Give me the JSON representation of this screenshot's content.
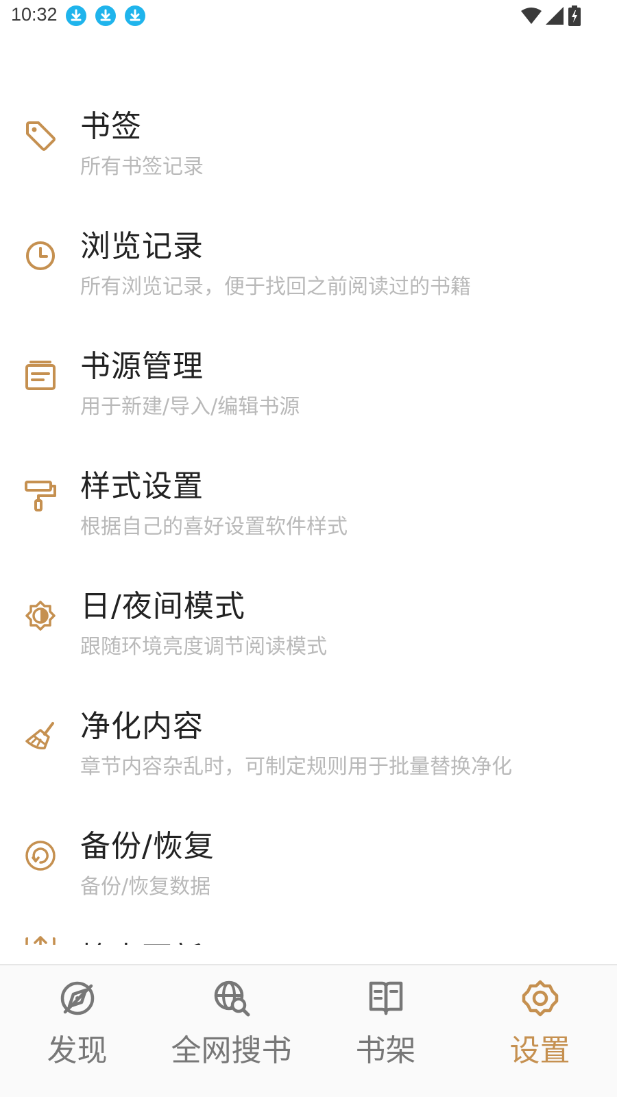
{
  "status_bar": {
    "time": "10:32",
    "download_icons": [
      "download-icon",
      "download-icon",
      "download-icon"
    ],
    "right_icons": [
      "wifi-icon",
      "cell-signal-icon",
      "battery-charging-icon"
    ]
  },
  "colors": {
    "accent": "#c59050",
    "title_text": "#222222",
    "desc_text": "#b9b9b9",
    "nav_inactive": "#777777",
    "download_badge": "#1fb4ec"
  },
  "settings": [
    {
      "icon": "tag-icon",
      "title": "书签",
      "desc": "所有书签记录"
    },
    {
      "icon": "clock-icon",
      "title": "浏览记录",
      "desc": "所有浏览记录，便于找回之前阅读过的书籍"
    },
    {
      "icon": "document-list-icon",
      "title": "书源管理",
      "desc": "用于新建/导入/编辑书源"
    },
    {
      "icon": "paint-roller-icon",
      "title": "样式设置",
      "desc": "根据自己的喜好设置软件样式"
    },
    {
      "icon": "day-night-icon",
      "title": "日/夜间模式",
      "desc": "跟随环境亮度调节阅读模式"
    },
    {
      "icon": "broom-icon",
      "title": "净化内容",
      "desc": "章节内容杂乱时，可制定规则用于批量替换净化"
    },
    {
      "icon": "restore-icon",
      "title": "备份/恢复",
      "desc": "备份/恢复数据"
    },
    {
      "icon": "update-icon",
      "title": "检查更新",
      "desc": ""
    }
  ],
  "bottom_nav": [
    {
      "icon": "compass-icon",
      "label": "发现",
      "active": false
    },
    {
      "icon": "web-search-icon",
      "label": "全网搜书",
      "active": false
    },
    {
      "icon": "bookshelf-icon",
      "label": "书架",
      "active": false
    },
    {
      "icon": "gear-icon",
      "label": "设置",
      "active": true
    }
  ]
}
